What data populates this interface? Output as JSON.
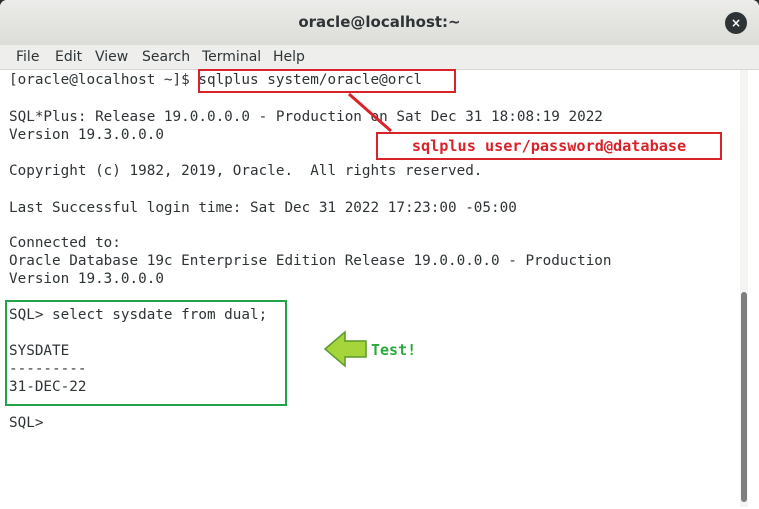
{
  "window": {
    "title": "oracle@localhost:~",
    "close_glyph": "×"
  },
  "menubar": {
    "items": [
      "File",
      "Edit",
      "View",
      "Search",
      "Terminal",
      "Help"
    ]
  },
  "terminal": {
    "prompt": "[oracle@localhost ~]$ ",
    "command": "sqlplus system/oracle@orcl",
    "lines": [
      "SQL*Plus: Release 19.0.0.0.0 - Production on Sat Dec 31 18:08:19 2022",
      "Version 19.3.0.0.0",
      "Copyright (c) 1982, 2019, Oracle.  All rights reserved.",
      "Last Successful login time: Sat Dec 31 2022 17:23:00 -05:00",
      "Connected to:",
      "Oracle Database 19c Enterprise Edition Release 19.0.0.0.0 - Production",
      "Version 19.3.0.0.0",
      "SQL> select sysdate from dual;",
      "SYSDATE",
      "---------",
      "31-DEC-22",
      "SQL>"
    ]
  },
  "annotations": {
    "syntax_callout": "sqlplus user/password@database",
    "test_label": "Test!",
    "red_color": "#d9232b",
    "green_color": "#23a246",
    "arrow_fill": "#a6d53b"
  }
}
